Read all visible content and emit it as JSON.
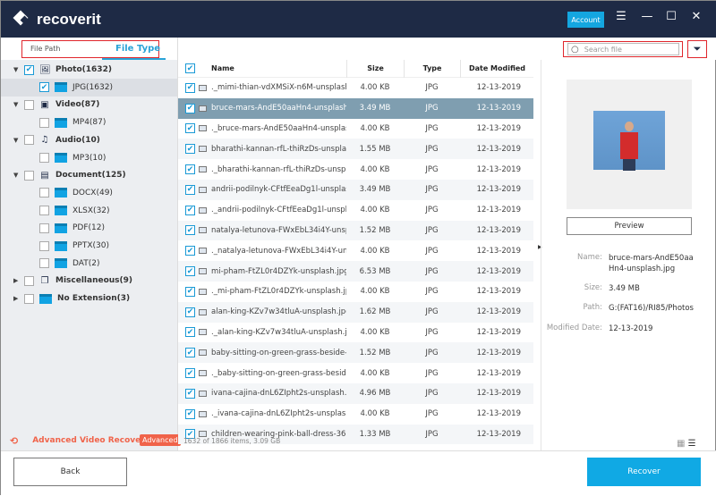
{
  "app": {
    "title": "recoverit",
    "account": "Account"
  },
  "tabs": {
    "file_path": "File Path",
    "file_type": "File Type"
  },
  "search": {
    "placeholder": "Search file"
  },
  "tree": [
    {
      "label": "Photo(1632)",
      "level": 0,
      "checked": true,
      "expanded": true,
      "icon": "photo-icon"
    },
    {
      "label": "JPG(1632)",
      "level": 1,
      "checked": true,
      "selected": true
    },
    {
      "label": "Video(87)",
      "level": 0,
      "checked": false,
      "expanded": true,
      "icon": "video-icon"
    },
    {
      "label": "MP4(87)",
      "level": 1,
      "checked": false
    },
    {
      "label": "Audio(10)",
      "level": 0,
      "checked": false,
      "expanded": true,
      "icon": "audio-icon"
    },
    {
      "label": "MP3(10)",
      "level": 1,
      "checked": false
    },
    {
      "label": "Document(125)",
      "level": 0,
      "checked": false,
      "expanded": true,
      "icon": "document-icon"
    },
    {
      "label": "DOCX(49)",
      "level": 1,
      "checked": false
    },
    {
      "label": "XLSX(32)",
      "level": 1,
      "checked": false
    },
    {
      "label": "PDF(12)",
      "level": 1,
      "checked": false
    },
    {
      "label": "PPTX(30)",
      "level": 1,
      "checked": false
    },
    {
      "label": "DAT(2)",
      "level": 1,
      "checked": false
    },
    {
      "label": "Miscellaneous(9)",
      "level": 0,
      "checked": false,
      "expanded": false,
      "icon": "misc-icon"
    },
    {
      "label": "No Extension(3)",
      "level": 0,
      "checked": false,
      "expanded": false,
      "icon": "folder-icon"
    }
  ],
  "advanced": {
    "label": "Advanced Video Recovery",
    "badge": "Advanced"
  },
  "table": {
    "columns": {
      "name": "Name",
      "size": "Size",
      "type": "Type",
      "date": "Date Modified"
    },
    "rows": [
      {
        "name": "._mimi-thian-vdXMSiX-n6M-unsplash...",
        "size": "4.00  KB",
        "type": "JPG",
        "date": "12-13-2019"
      },
      {
        "name": "bruce-mars-AndE50aaHn4-unsplash...",
        "size": "3.49  MB",
        "type": "JPG",
        "date": "12-13-2019",
        "selected": true
      },
      {
        "name": "._bruce-mars-AndE50aaHn4-unsplas...",
        "size": "4.00  KB",
        "type": "JPG",
        "date": "12-13-2019"
      },
      {
        "name": "bharathi-kannan-rfL-thiRzDs-unsplas...",
        "size": "1.55  MB",
        "type": "JPG",
        "date": "12-13-2019"
      },
      {
        "name": "._bharathi-kannan-rfL-thiRzDs-unspl...",
        "size": "4.00  KB",
        "type": "JPG",
        "date": "12-13-2019"
      },
      {
        "name": "andrii-podilnyk-CFtfEeaDg1l-unsplas...",
        "size": "3.49  MB",
        "type": "JPG",
        "date": "12-13-2019"
      },
      {
        "name": "._andrii-podilnyk-CFtfEeaDg1l-unspla...",
        "size": "4.00  KB",
        "type": "JPG",
        "date": "12-13-2019"
      },
      {
        "name": "natalya-letunova-FWxEbL34i4Y-unspl...",
        "size": "1.52  MB",
        "type": "JPG",
        "date": "12-13-2019"
      },
      {
        "name": "._natalya-letunova-FWxEbL34i4Y-uns...",
        "size": "4.00  KB",
        "type": "JPG",
        "date": "12-13-2019"
      },
      {
        "name": "mi-pham-FtZL0r4DZYk-unsplash.jpg",
        "size": "6.53  MB",
        "type": "JPG",
        "date": "12-13-2019"
      },
      {
        "name": "._mi-pham-FtZL0r4DZYk-unsplash.jpg",
        "size": "4.00  KB",
        "type": "JPG",
        "date": "12-13-2019"
      },
      {
        "name": "alan-king-KZv7w34tluA-unsplash.jpg",
        "size": "1.62  MB",
        "type": "JPG",
        "date": "12-13-2019"
      },
      {
        "name": "._alan-king-KZv7w34tluA-unsplash.jpg",
        "size": "4.00  KB",
        "type": "JPG",
        "date": "12-13-2019"
      },
      {
        "name": "baby-sitting-on-green-grass-beside-...",
        "size": "1.52  MB",
        "type": "JPG",
        "date": "12-13-2019"
      },
      {
        "name": "._baby-sitting-on-green-grass-beside...",
        "size": "4.00  KB",
        "type": "JPG",
        "date": "12-13-2019"
      },
      {
        "name": "ivana-cajina-dnL6ZIpht2s-unsplash.jpg",
        "size": "4.96  MB",
        "type": "JPG",
        "date": "12-13-2019"
      },
      {
        "name": "._ivana-cajina-dnL6ZIpht2s-unsplash....",
        "size": "4.00  KB",
        "type": "JPG",
        "date": "12-13-2019"
      },
      {
        "name": "children-wearing-pink-ball-dress-360...",
        "size": "1.33  MB",
        "type": "JPG",
        "date": "12-13-2019"
      }
    ]
  },
  "status": "1632 of 1866 items, 3.09  GB",
  "details": {
    "preview_button": "Preview",
    "name_label": "Name:",
    "name": "bruce-mars-AndE50aaHn4-unsplash.jpg",
    "size_label": "Size:",
    "size": "3.49  MB",
    "path_label": "Path:",
    "path": "G:(FAT16)/RI85/Photos",
    "date_label": "Modified Date:",
    "date": "12-13-2019"
  },
  "footer": {
    "back": "Back",
    "recover": "Recover"
  },
  "colors": {
    "accent": "#10a9e4",
    "titlebar": "#1e2a45",
    "advanced": "#f0634a",
    "selected_row": "#7f9eb0"
  }
}
